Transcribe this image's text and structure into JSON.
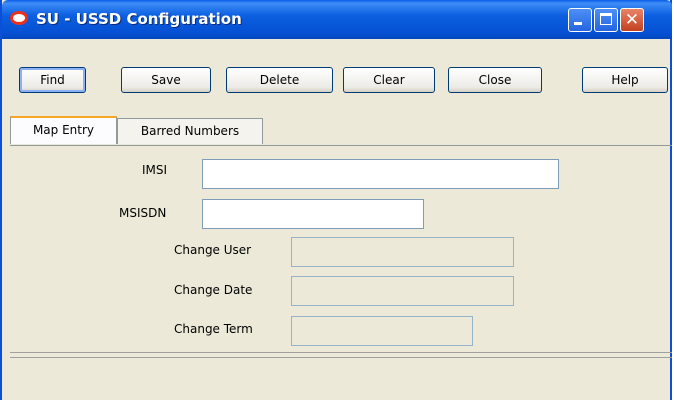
{
  "window": {
    "title": "SU - USSD Configuration",
    "icon": "oracle-logo-icon",
    "controls": [
      "minimize-icon",
      "maximize-icon",
      "close-icon"
    ]
  },
  "toolbar": {
    "find_label": "Find",
    "save_label": "Save",
    "delete_label": "Delete",
    "clear_label": "Clear",
    "close_label": "Close",
    "help_label": "Help"
  },
  "tabs": [
    {
      "label": "Map Entry",
      "active": true
    },
    {
      "label": "Barred Numbers",
      "active": false
    }
  ],
  "form": {
    "imsi_label": "IMSI",
    "imsi_value": "",
    "msisdn_label": "MSISDN",
    "msisdn_value": "",
    "change_user_label": "Change User",
    "change_user_value": "",
    "change_date_label": "Change Date",
    "change_date_value": "",
    "change_term_label": "Change Term",
    "change_term_value": ""
  },
  "colors": {
    "titlebar": "#0550d3",
    "window_bg": "#ece9d8",
    "close_button": "#c4401f",
    "active_tab_accent": "#f5a623"
  }
}
